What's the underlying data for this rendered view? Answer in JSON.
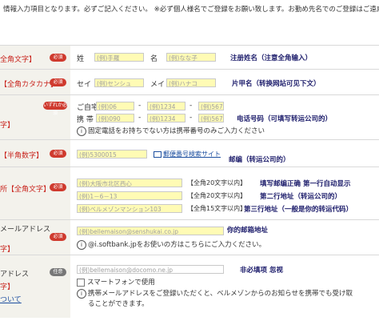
{
  "top_note": {
    "line1": "情報入力項目となります。必ずご記入ください。  ※必ず個人様名でご登録をお願い致します。お勤め先名でのご登録はご遠慮",
    "line2": ""
  },
  "badges": {
    "required": "必須",
    "optional": "任意",
    "either": "いずれか必須"
  },
  "name": {
    "label": "全角文字】",
    "sei_label": "姓",
    "sei_placeholder": "(例)手羅",
    "mei_label": "名",
    "mei_placeholder": "(例)なな子",
    "annotation": "注册姓名（注意全角输入）"
  },
  "kana": {
    "label": "【全角カタカナ】",
    "sei_label": "セイ",
    "sei_placeholder": "(例)センシュ",
    "mei_label": "メイ",
    "mei_placeholder": "(例)ハナコ",
    "annotation": "片甲名（转换网站可见下文）"
  },
  "phone": {
    "label": "字】",
    "home_label": "ご自宅",
    "mobile_label": "携 帯",
    "home_placeholders": [
      "(例)06",
      "(例)1234",
      "(例)5678"
    ],
    "mobile_placeholders": [
      "(例)090",
      "(例)1234",
      "(例)5678"
    ],
    "dash": "-",
    "note": "固定電話をお持ちでない方は携帯番号のみご入力ください",
    "annotation": "电话号码（可填写转运公司的）"
  },
  "postal": {
    "label": "【半角数字】",
    "placeholder": "(例)5300015",
    "link": "郵便番号検索サイト",
    "annotation": "邮编（转运公司的）"
  },
  "address": {
    "label": "所【全角文字】",
    "line1_placeholder": "(例)大阪市北区西心",
    "line1_hint": "【全角20文字以内】",
    "line1_annotation": "填写邮编正确 第一行自动显示",
    "line2_placeholder": "(例)1－6－13",
    "line2_hint": "【全角20文字以内】",
    "line2_annotation": "第二行地址（转运公司的）",
    "line3_placeholder": "(例)ベルメゾンマンション103",
    "line3_hint": "【全角15文字以内】",
    "line3_annotation": "第三行地址（一般是你的转运代码）"
  },
  "email": {
    "label": "メールアドレス",
    "label2": "字】",
    "placeholder": "(例)bellemaison@senshukai.co.jp",
    "annotation": "你的邮箱地址",
    "note": "@i.softbank.jpをお使いの方はこちらにご入力ください。"
  },
  "mobile_email": {
    "label": "アドレス",
    "label2": "字】",
    "label3": "ついて",
    "placeholder": "(例)bellemaison@docomo.ne.jp",
    "annotation": "非必填项 忽视",
    "checkbox_label": "スマートフォンで使用",
    "note_line1": "携帯メールアドレスをご登録いただくと、ベルメゾンからのお知らせを携帯でも受け取",
    "note_line2": "ることができます。"
  },
  "colors": {
    "required_badge": "#cf3a2e",
    "optional_badge": "#777777",
    "field_fill": "#fffbb5",
    "label_bg": "#f3f2ec",
    "annotation": "#1c1c6b",
    "link": "#1d4fa0"
  }
}
